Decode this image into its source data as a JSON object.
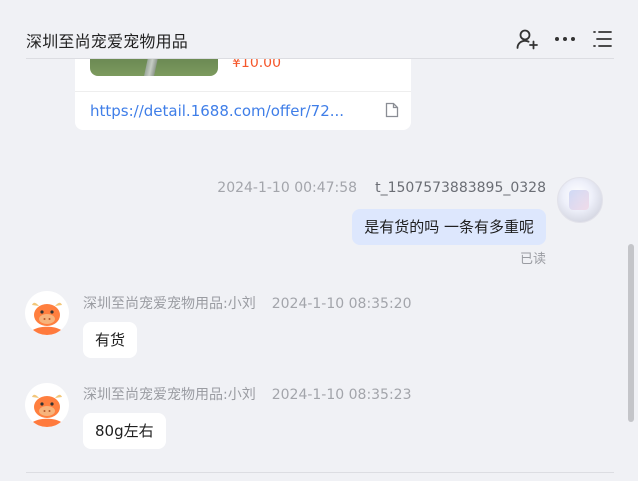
{
  "header": {
    "title": "深圳至尚宠爱宠物用品",
    "icons": [
      "add-user-icon",
      "more-icon",
      "menu-list-icon"
    ]
  },
  "product_card": {
    "price": "¥10.00",
    "link": "https://detail.1688.com/offer/72..."
  },
  "messages": [
    {
      "side": "right",
      "timestamp": "2024-1-10 00:47:58",
      "sender": "t_1507573883895_0328",
      "text": "是有货的吗 一条有多重呢",
      "status": "已读"
    },
    {
      "side": "left",
      "sender": "深圳至尚宠爱宠物用品:小刘",
      "timestamp": "2024-1-10 08:35:20",
      "text": "有货"
    },
    {
      "side": "left",
      "sender": "深圳至尚宠爱宠物用品:小刘",
      "timestamp": "2024-1-10 08:35:23",
      "text": "80g左右"
    }
  ],
  "colors": {
    "background": "#f0f1f5",
    "price": "#f5572b",
    "link": "#3f7ee8",
    "outgoing_bubble": "#dde7fd",
    "incoming_bubble": "#ffffff"
  }
}
